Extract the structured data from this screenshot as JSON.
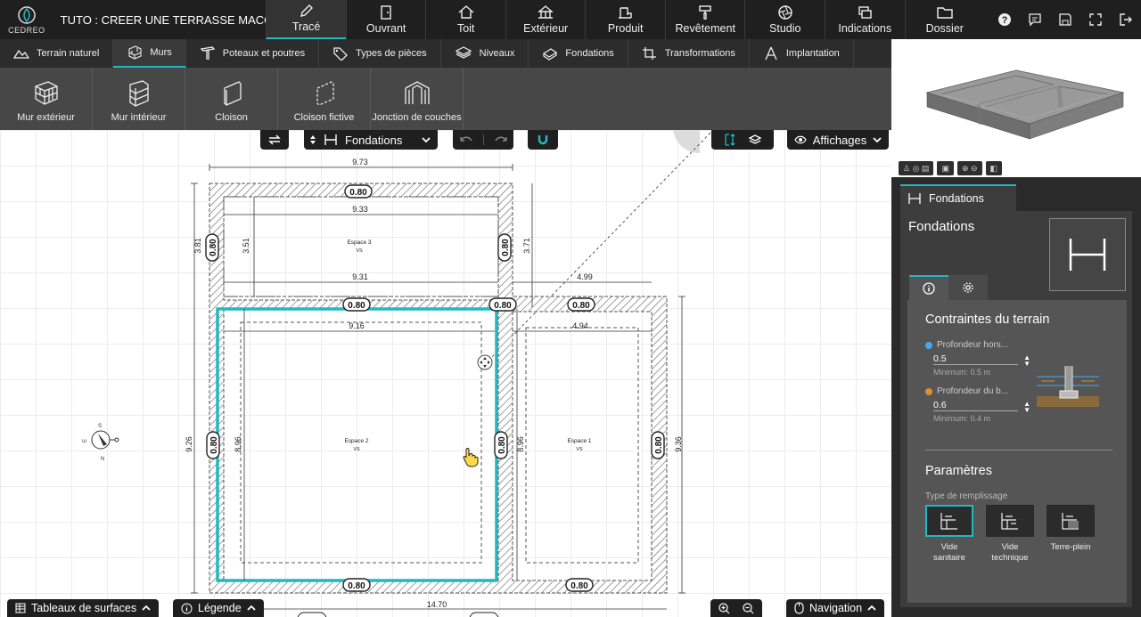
{
  "app": {
    "logo_text": "CEDREO",
    "project_title": "TUTO : CREER UNE TERRASSE MACO..."
  },
  "main_tabs": [
    {
      "label": "Tracé",
      "icon": "pencil-icon"
    },
    {
      "label": "Ouvrant",
      "icon": "door-icon"
    },
    {
      "label": "Toit",
      "icon": "roof-icon"
    },
    {
      "label": "Extérieur",
      "icon": "tree-icon"
    },
    {
      "label": "Produit",
      "icon": "sofa-icon"
    },
    {
      "label": "Revêtement",
      "icon": "paint-roller-icon"
    },
    {
      "label": "Studio",
      "icon": "camera-aperture-icon"
    },
    {
      "label": "Indications",
      "icon": "signs-icon"
    },
    {
      "label": "Dossier",
      "icon": "folder-icon"
    }
  ],
  "active_main_tab": "Tracé",
  "sub_tabs": [
    {
      "label": "Terrain naturel",
      "icon": "mountain-icon"
    },
    {
      "label": "Murs",
      "icon": "wall-icon"
    },
    {
      "label": "Poteaux et poutres",
      "icon": "beam-icon"
    },
    {
      "label": "Types de pièces",
      "icon": "tag-icon"
    },
    {
      "label": "Niveaux",
      "icon": "layers-icon"
    },
    {
      "label": "Fondations",
      "icon": "foundation-icon"
    },
    {
      "label": "Transformations",
      "icon": "crop-icon"
    },
    {
      "label": "Implantation",
      "icon": "compass-tool-icon"
    }
  ],
  "active_sub_tab": "Murs",
  "wall_tools": [
    {
      "label": "Mur extérieur"
    },
    {
      "label": "Mur intérieur"
    },
    {
      "label": "Cloison"
    },
    {
      "label": "Cloison fictive"
    },
    {
      "label": "Jonction de couches"
    }
  ],
  "canvas_toolbar": {
    "level_select": "Fondations",
    "display_label": "Affichages"
  },
  "plan": {
    "dimensions": [
      "9.73",
      "9.33",
      "9.31",
      "4.99",
      "9.16",
      "4.94",
      "3.81",
      "3.51",
      "3.71",
      "9.26",
      "8.96",
      "8.96",
      "9.36",
      "14.70"
    ],
    "badges": [
      "0.80"
    ],
    "rooms": [
      {
        "name": "Espace 3",
        "sub": "VS"
      },
      {
        "name": "Espace 2",
        "sub": "VS"
      },
      {
        "name": "Espace 1",
        "sub": "VS"
      }
    ],
    "compass": {
      "n": "N",
      "s": "S",
      "e": "E"
    }
  },
  "right_panel": {
    "tab_label": "Fondations",
    "title": "Fondations",
    "section_terrain": "Contraintes du terrain",
    "fields": [
      {
        "label": "Profondeur hors...",
        "value": "0.5",
        "min": "Minimum: 0.5 m",
        "color": "#4aa8e8"
      },
      {
        "label": "Profondeur du b...",
        "value": "0.6",
        "min": "Minimum: 0.4 m",
        "color": "#d89030"
      }
    ],
    "section_params": "Paramètres",
    "fill_type_label": "Type de remplissage",
    "fill_options": [
      {
        "line1": "Vide",
        "line2": "sanitaire"
      },
      {
        "line1": "Vide",
        "line2": "technique"
      },
      {
        "line1": "Terre-plein",
        "line2": ""
      }
    ],
    "active_fill": "Vide sanitaire"
  },
  "bottom_bar": {
    "surfaces": "Tableaux de surfaces",
    "legend": "Légende",
    "navigation": "Navigation"
  },
  "accent_color": "#22b8c0"
}
